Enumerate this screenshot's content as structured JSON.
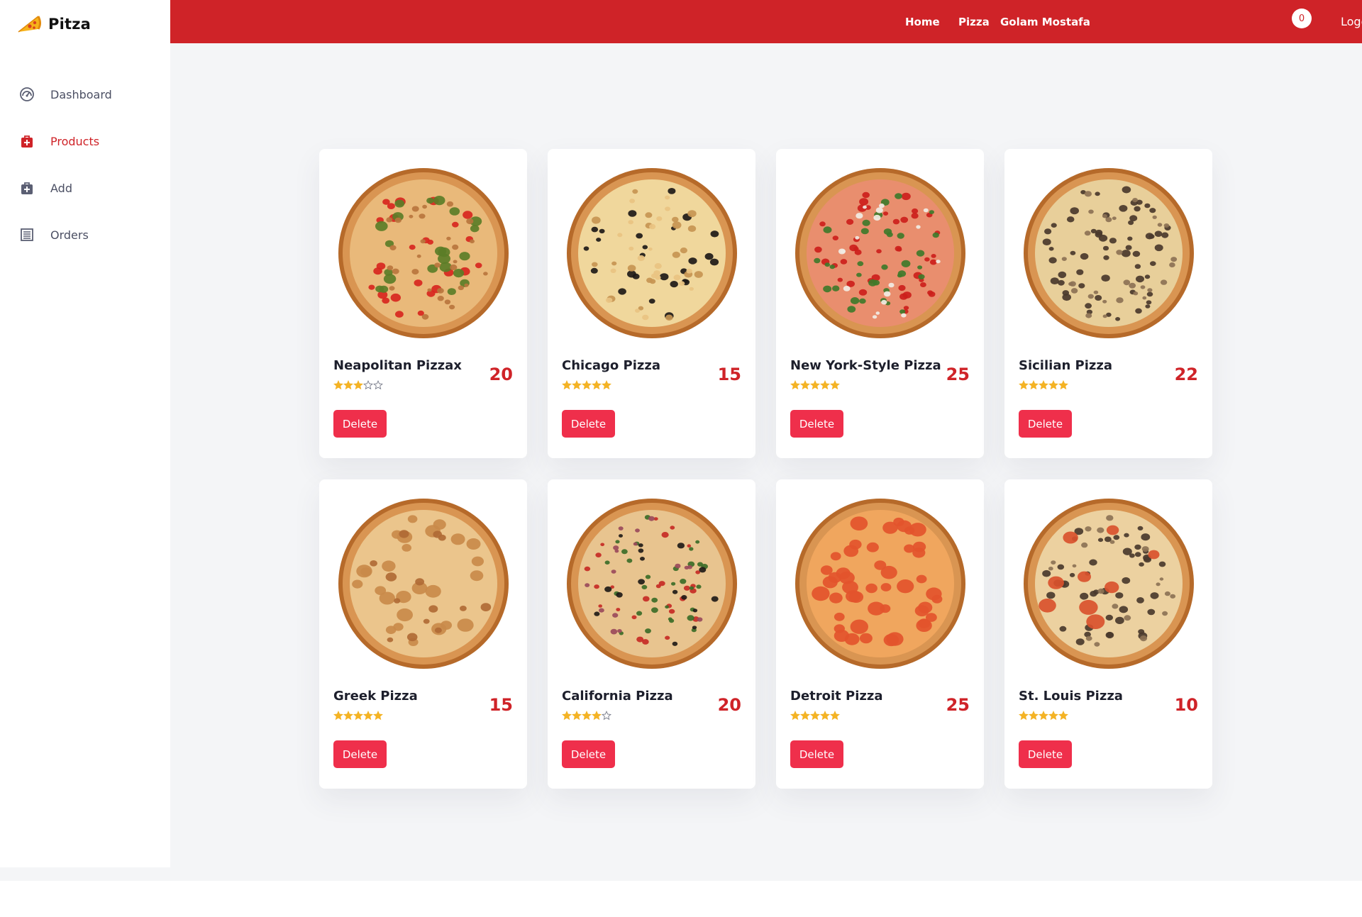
{
  "brand": {
    "name": "Pitza",
    "logo_icon": "pizza-slice-icon"
  },
  "sidebar": {
    "items": [
      {
        "label": "Dashboard",
        "icon": "gauge-icon",
        "active": false
      },
      {
        "label": "Products",
        "icon": "medkit-bag-icon",
        "active": true
      },
      {
        "label": "Add",
        "icon": "bag-plus-icon",
        "active": false
      },
      {
        "label": "Orders",
        "icon": "list-icon",
        "active": false
      }
    ]
  },
  "header": {
    "links": [
      "Home",
      "Pizza"
    ],
    "user_name": "Golam Mostafa",
    "cart_count": "0",
    "logout_label": "Logout"
  },
  "colors": {
    "brand_red": "#cf2328",
    "button_red": "#ef2f4b",
    "star_gold": "#f4b324",
    "page_bg": "#f4f5f7"
  },
  "products": [
    {
      "name": "Neapolitan Pizzax",
      "price": "20",
      "rating": 3,
      "delete_label": "Delete",
      "style": "jalapeno"
    },
    {
      "name": "Chicago Pizza",
      "price": "15",
      "rating": 5,
      "delete_label": "Delete",
      "style": "olive"
    },
    {
      "name": "New York-Style Pizza",
      "price": "25",
      "rating": 5,
      "delete_label": "Delete",
      "style": "veggie"
    },
    {
      "name": "Sicilian Pizza",
      "price": "22",
      "rating": 5,
      "delete_label": "Delete",
      "style": "mushroom"
    },
    {
      "name": "Greek Pizza",
      "price": "15",
      "rating": 5,
      "delete_label": "Delete",
      "style": "cheese"
    },
    {
      "name": "California Pizza",
      "price": "20",
      "rating": 4,
      "delete_label": "Delete",
      "style": "supreme"
    },
    {
      "name": "Detroit Pizza",
      "price": "25",
      "rating": 5,
      "delete_label": "Delete",
      "style": "tomato"
    },
    {
      "name": "St. Louis Pizza",
      "price": "10",
      "rating": 5,
      "delete_label": "Delete",
      "style": "mushroom-tomato"
    }
  ]
}
